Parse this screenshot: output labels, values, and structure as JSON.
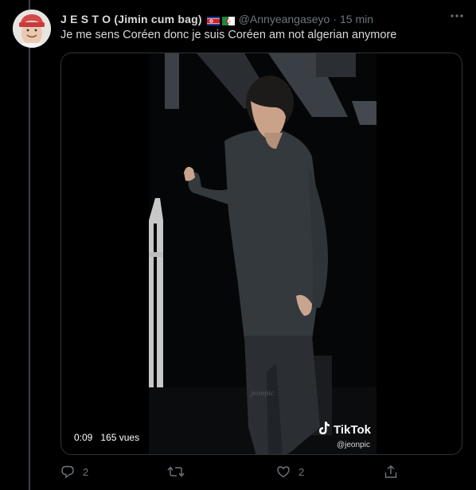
{
  "tweet": {
    "author_name": "J E S T O (Jimin cum bag)",
    "flags": [
      "north-korea-flag",
      "algeria-flag"
    ],
    "handle": "@Annyeangaseyo",
    "separator": "·",
    "time": "15 min",
    "text": "Je me sens Coréen donc je suis Coréen am not algerian anymore"
  },
  "video": {
    "elapsed": "0:09",
    "views": "165 vues",
    "watermark_brand": "TikTok",
    "watermark_user": "@jeonpic"
  },
  "actions": {
    "reply_count": "2",
    "retweet_count": "",
    "like_count": "2"
  },
  "colors": {
    "background": "#000000",
    "text_primary": "#d9d9d9",
    "text_secondary": "#6e767d",
    "border": "#2f3336"
  }
}
